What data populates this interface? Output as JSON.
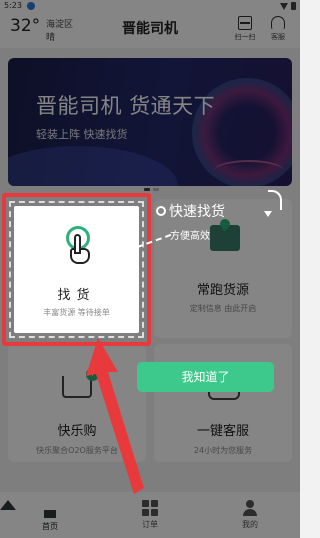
{
  "status_bar": {
    "time": "5:23"
  },
  "header": {
    "temperature": "32°",
    "district": "海淀区",
    "weather": "晴",
    "title": "晋能司机",
    "scan_label": "扫一扫",
    "service_label": "客服"
  },
  "banner": {
    "title": "晋能司机 货通天下",
    "subtitle": "轻装上阵  快速找货"
  },
  "cards": {
    "find_goods": {
      "title": "找货",
      "subtitle": "丰富货源  等待接单"
    },
    "regular_goods": {
      "title": "常跑货源",
      "subtitle": "定制信息  由此开启"
    },
    "happy_shop": {
      "title": "快乐购",
      "subtitle": "快乐聚合O2O服务平台",
      "badge": "¥"
    },
    "customer_service": {
      "title": "一键客服",
      "subtitle": "24小时为您服务"
    }
  },
  "guide": {
    "tip_title": "快速找货",
    "tip_subtitle": "方便高效",
    "confirm_button": "我知道了"
  },
  "bottom_nav": {
    "items": [
      {
        "label": "首页",
        "icon": "home-icon",
        "active": true
      },
      {
        "label": "订单",
        "icon": "orders-icon",
        "active": false
      },
      {
        "label": "我的",
        "icon": "profile-icon",
        "active": false
      }
    ]
  },
  "colors": {
    "accent": "#3ec98c",
    "highlight_frame": "#e8393c",
    "banner_bg": "#232a6a"
  }
}
